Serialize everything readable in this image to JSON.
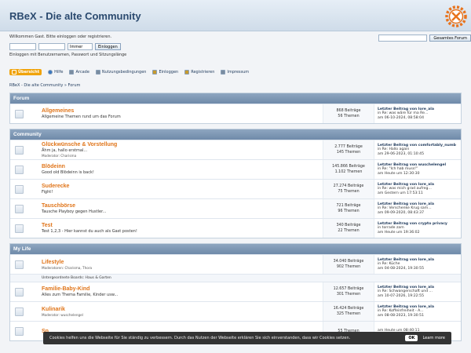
{
  "header": {
    "title": "RBeX - Die alte Community"
  },
  "userbar": {
    "welcome": "Willkommen Gast. Bitte einloggen oder registrieren.",
    "duration": "Immer",
    "login_button": "Einloggen",
    "hint": "Einloggen mit Benutzernamen, Passwort und Sitzungslänge",
    "search_button": "Gesamtes Forum"
  },
  "nav": {
    "items": [
      {
        "label": "Übersicht",
        "icon": "home-icon"
      },
      {
        "label": "Hilfe",
        "icon": "help-icon"
      },
      {
        "label": "Arcade",
        "icon": "arcade-icon"
      },
      {
        "label": "Nutzungsbedingungen",
        "icon": "terms-icon"
      },
      {
        "label": "Einloggen",
        "icon": "login-icon"
      },
      {
        "label": "Registrieren",
        "icon": "register-icon"
      },
      {
        "label": "Impressum",
        "icon": "imprint-icon"
      }
    ]
  },
  "breadcrumb": "RBeX - Die alte Community » Forum",
  "categories": [
    {
      "name": "Forum",
      "boards": [
        {
          "name": "Allgemeines",
          "desc": "Allgemeine Themen rund um das Forum",
          "mod": "",
          "posts": "868 Beiträge",
          "topics": "56 Themen",
          "last1": "Letzter Beitrag von lore_ala",
          "last2": "in Re: was wäre für ma Re...",
          "last3": "am 06-10-2024, 08:58:04"
        }
      ]
    },
    {
      "name": "Community",
      "boards": [
        {
          "name": "Glückwünsche & Vorstellung",
          "desc": "Ähm ja, hallo erstmal...",
          "mod": "Moderator: Charisma",
          "posts": "2.777 Beiträge",
          "topics": "145 Themen",
          "last1": "Letzter Beitrag von comfortably_numb",
          "last2": "in Re: Hallo again",
          "last3": "am 29-06-2023, 01:10:45"
        },
        {
          "name": "Blödeinn",
          "desc": "Good old Blödeinn is back!",
          "mod": "",
          "posts": "145.866 Beiträge",
          "topics": "1.102 Themen",
          "last1": "Letzter Beitrag von wuschelengel",
          "last2": "in Re: \"Ich hab muss!\"",
          "last3": "am Heute um 12:30:30"
        },
        {
          "name": "Suderecke",
          "desc": "Fight!",
          "mod": "",
          "posts": "27.274 Beiträge",
          "topics": "75 Themen",
          "last1": "Letzter Beitrag von lore_ala",
          "last2": "in Re: was mich grad aufreg...",
          "last3": "am Gestern um 17:53:11"
        },
        {
          "name": "Tauschbörse",
          "desc": "Tausche Playboy gegen Hustler...",
          "mod": "",
          "posts": "721 Beiträge",
          "topics": "96 Themen",
          "last1": "Letzter Beitrag von lore_ala",
          "last2": "in Re: Verschenke Krug sam...",
          "last3": "am 09-09-2020, 08:43:37"
        },
        {
          "name": "Test",
          "desc": "Test 1,2,3 - Hier kannst du auch als Gast posten!",
          "mod": "",
          "posts": "340 Beiträge",
          "topics": "22 Themen",
          "last1": "Letzter Beitrag von crypto privacy",
          "last2": "in torrade zam",
          "last3": "am Heute um 19:36:02"
        }
      ]
    },
    {
      "name": "My Life",
      "boards": [
        {
          "name": "Lifestyle",
          "desc": "",
          "mod": "Moderatoren: Charisma, Thora",
          "posts": "34.040 Beiträge",
          "topics": "902 Themen",
          "last1": "Letzter Beitrag von lore_ala",
          "last2": "in Re: Küche",
          "last3": "am 04-08-2024, 19:30:55"
        },
        {
          "name": "Familie-Baby-Kind",
          "desc": "Alles zum Thema Familie, Kinder usw...",
          "mod": "",
          "posts": "12.657 Beiträge",
          "topics": "301 Themen",
          "last1": "Letzter Beitrag von lore_ala",
          "last2": "in Re: Schwangerschaft und ...",
          "last3": "am 10-07-2026, 19:22:55"
        },
        {
          "name": "Kulinarik",
          "desc": "",
          "mod": "Moderator: wuschelengel",
          "posts": "16.424 Beiträge",
          "topics": "325 Themen",
          "last1": "Letzter Beitrag von lore_ala",
          "last2": "in Re: Koffeinfreiheit - A...",
          "last3": "am 08-08-2023, 19:30:51"
        },
        {
          "name": "Sp",
          "desc": "",
          "mod": "",
          "posts": "",
          "topics": "55 Themen",
          "last1": "",
          "last2": "",
          "last3": "am Heute um 08:40:11"
        }
      ],
      "subboards": "Untergeordnete Boards: Haus & Garten"
    }
  ],
  "cookie": {
    "text": "Cookies helfen uns die Webseite für Sie ständig zu verbessern. Durch das Nutzen der Webseite erklären Sie sich einverstanden, dass wir Cookies setzen.",
    "ok": "OK",
    "more": "Learn more"
  },
  "colors": {
    "accent": "#f0a30a",
    "link": "#e0751a",
    "header_bar": "#7f98b5"
  }
}
